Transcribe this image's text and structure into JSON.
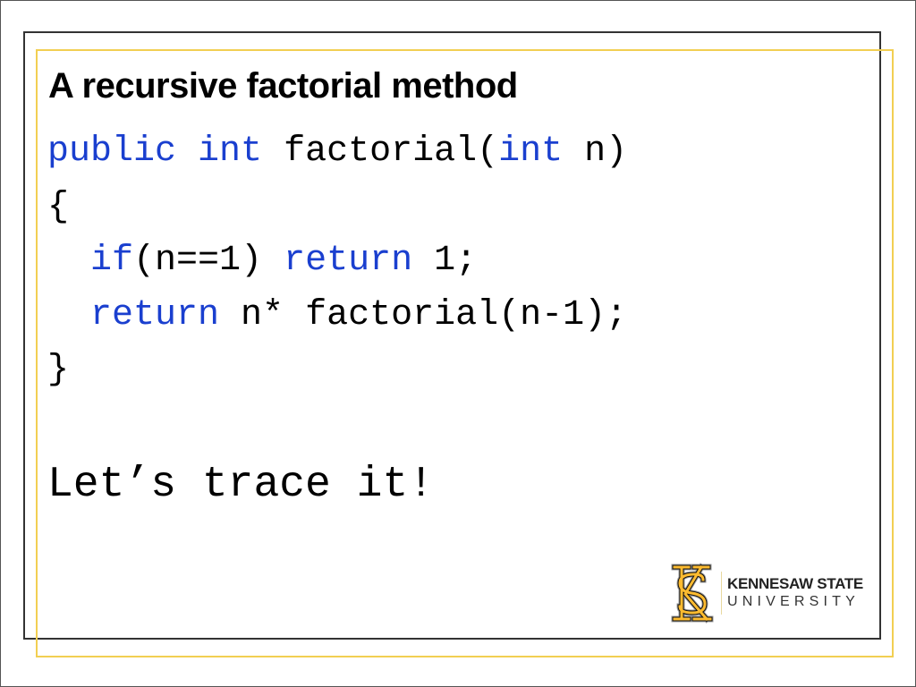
{
  "slide": {
    "title": "A recursive factorial method",
    "code_lines": [
      [
        {
          "t": "public",
          "kw": true
        },
        {
          "t": " "
        },
        {
          "t": "int",
          "kw": true
        },
        {
          "t": " factorial("
        },
        {
          "t": "int",
          "kw": true
        },
        {
          "t": " n)"
        }
      ],
      [
        {
          "t": "{"
        }
      ],
      [
        {
          "t": "  "
        },
        {
          "t": "if",
          "kw": true
        },
        {
          "t": "(n==1) "
        },
        {
          "t": "return",
          "kw": true
        },
        {
          "t": " 1;"
        }
      ],
      [
        {
          "t": "  "
        },
        {
          "t": "return",
          "kw": true
        },
        {
          "t": " n* factorial(n-1);"
        }
      ],
      [
        {
          "t": "}"
        }
      ]
    ],
    "trace_text": "Let’s trace it!"
  },
  "logo": {
    "icon": "ks-monogram-icon",
    "line1": "KENNESAW STATE",
    "line2": "UNIVERSITY"
  },
  "colors": {
    "keyword": "#1a3fcf",
    "gold_frame": "#f2cf52",
    "dark_frame": "#333333",
    "ksu_gold": "#fdbb30"
  }
}
